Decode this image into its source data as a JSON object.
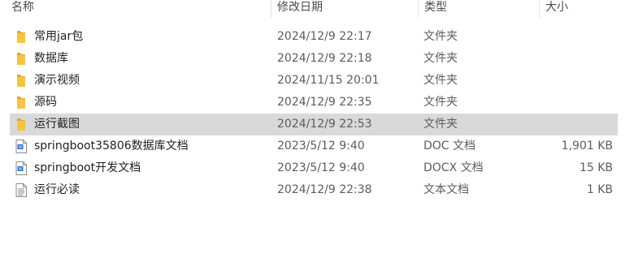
{
  "columns": {
    "name": "名称",
    "date": "修改日期",
    "type": "类型",
    "size": "大小"
  },
  "files": [
    {
      "name": "常用jar包",
      "date": "2024/12/9 22:17",
      "type": "文件夹",
      "size": "",
      "icon": "folder-icon",
      "selected": false
    },
    {
      "name": "数据库",
      "date": "2024/12/9 22:18",
      "type": "文件夹",
      "size": "",
      "icon": "folder-icon",
      "selected": false
    },
    {
      "name": "演示视频",
      "date": "2024/11/15 20:01",
      "type": "文件夹",
      "size": "",
      "icon": "folder-icon",
      "selected": false
    },
    {
      "name": "源码",
      "date": "2024/12/9 22:35",
      "type": "文件夹",
      "size": "",
      "icon": "folder-icon",
      "selected": false
    },
    {
      "name": "运行截图",
      "date": "2024/12/9 22:53",
      "type": "文件夹",
      "size": "",
      "icon": "folder-icon",
      "selected": true
    },
    {
      "name": "springboot35806数据库文档",
      "date": "2023/5/12 9:40",
      "type": "DOC 文档",
      "size": "1,901 KB",
      "icon": "word-doc-icon",
      "selected": false
    },
    {
      "name": "springboot开发文档",
      "date": "2023/5/12 9:40",
      "type": "DOCX 文档",
      "size": "15 KB",
      "icon": "word-doc-icon",
      "selected": false
    },
    {
      "name": "运行必读",
      "date": "2024/12/9 22:38",
      "type": "文本文档",
      "size": "1 KB",
      "icon": "text-file-icon",
      "selected": false
    }
  ],
  "colors": {
    "folder": "#f4c542",
    "folder_dark": "#e0a82e",
    "word": "#2b6fd6",
    "selection": "#d9d9d9"
  }
}
